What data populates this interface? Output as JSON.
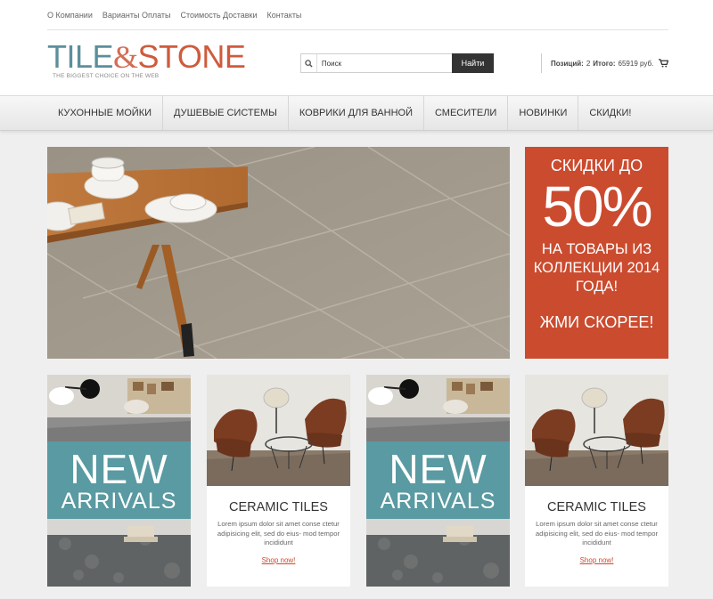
{
  "top_links": [
    "О Компании",
    "Варианты Оплаты",
    "Стоимость Доставки",
    "Контакты"
  ],
  "logo": {
    "part1": "TILE",
    "amp": "&",
    "part2": "STONE",
    "tagline": "THE BIGGEST CHOICE ON THE WEB"
  },
  "search": {
    "placeholder": "Поиск",
    "button": "Найти"
  },
  "cart": {
    "positions_label": "Позиций:",
    "positions": "2",
    "total_label": "Итого:",
    "total": "65919 руб."
  },
  "nav": [
    "КУХОННЫЕ МОЙКИ",
    "ДУШЕВЫЕ СИСТЕМЫ",
    "КОВРИКИ ДЛЯ ВАННОЙ",
    "СМЕСИТЕЛИ",
    "НОВИНКИ",
    "СКИДКИ!"
  ],
  "promo": {
    "line1": "СКИДКИ ДО",
    "percent": "50%",
    "line2": "НА ТОВАРЫ ИЗ КОЛЛЕКЦИИ 2014 ГОДА!",
    "line3": "ЖМИ СКОРЕЕ!"
  },
  "arrivals": {
    "new": "NEW",
    "sub": "ARRIVALS"
  },
  "ceramic": {
    "title": "CERAMIC TILES",
    "text": "Lorem ipsum dolor sit amet conse ctetur adipisicing elit, sed do eius- mod tempor incididunt",
    "link": "Shop now!"
  },
  "colors": {
    "accent_red": "#cb4b2f",
    "teal": "#5a9aa2",
    "logo_teal": "#5b8f9a"
  }
}
